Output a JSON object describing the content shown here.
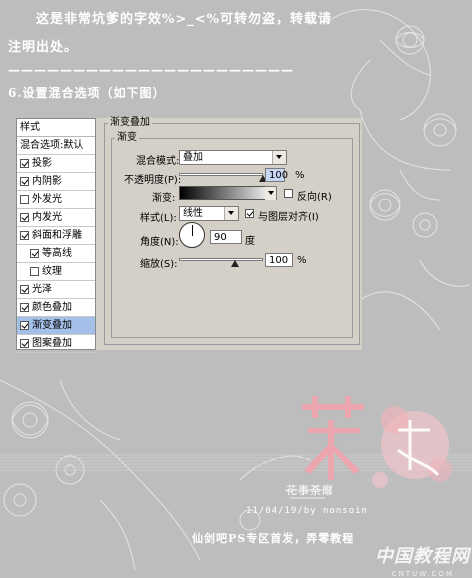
{
  "text": {
    "line1": "这是非常坑爹的字效%>_<%可转勿盗，转载请",
    "line2": "注明出处。",
    "dashes": "——————————————————————",
    "step": "6.设置混合选项（如下图）"
  },
  "styles_panel": {
    "header": "样式",
    "blend_options": "混合选项:默认",
    "items": [
      {
        "label": "投影",
        "checked": true
      },
      {
        "label": "内阴影",
        "checked": true
      },
      {
        "label": "外发光",
        "checked": false
      },
      {
        "label": "内发光",
        "checked": true
      },
      {
        "label": "斜面和浮雕",
        "checked": true
      },
      {
        "label": "等高线",
        "checked": true,
        "indent": true
      },
      {
        "label": "纹理",
        "checked": false,
        "indent": true
      },
      {
        "label": "光泽",
        "checked": true
      },
      {
        "label": "颜色叠加",
        "checked": true
      },
      {
        "label": "渐变叠加",
        "checked": true,
        "selected": true
      },
      {
        "label": "图案叠加",
        "checked": true
      }
    ]
  },
  "gradient_overlay": {
    "group_title": "渐变叠加",
    "subgroup_title": "渐变",
    "blend_mode_label": "混合模式:",
    "blend_mode_value": "叠加",
    "opacity_label": "不透明度(P):",
    "opacity_value": "100",
    "opacity_unit": "%",
    "opacity_level": 1.0,
    "gradient_label": "渐变:",
    "reverse_label": "反向(R)",
    "reverse_checked": false,
    "style_label": "样式(L):",
    "style_value": "线性",
    "align_label": "与图层对齐(I)",
    "align_checked": true,
    "angle_label": "角度(N):",
    "angle_value": "90",
    "angle_unit": "度",
    "scale_label": "缩放(S):",
    "scale_value": "100",
    "scale_unit": "%",
    "scale_level": 0.67
  },
  "signature": {
    "line1": "花事荼靡",
    "line2": "11/04/19/by nonsoin",
    "tagline": "仙剑吧PS专区首发，弄零教程"
  },
  "watermark": {
    "brand": "中国教程网",
    "sub": "CNTUW.COM"
  },
  "colors": {
    "background": "#bdbdbd",
    "dialog": "#d4d0c8",
    "selected_row": "#a4c0e8",
    "logo_pink": "#f2a3ad"
  }
}
